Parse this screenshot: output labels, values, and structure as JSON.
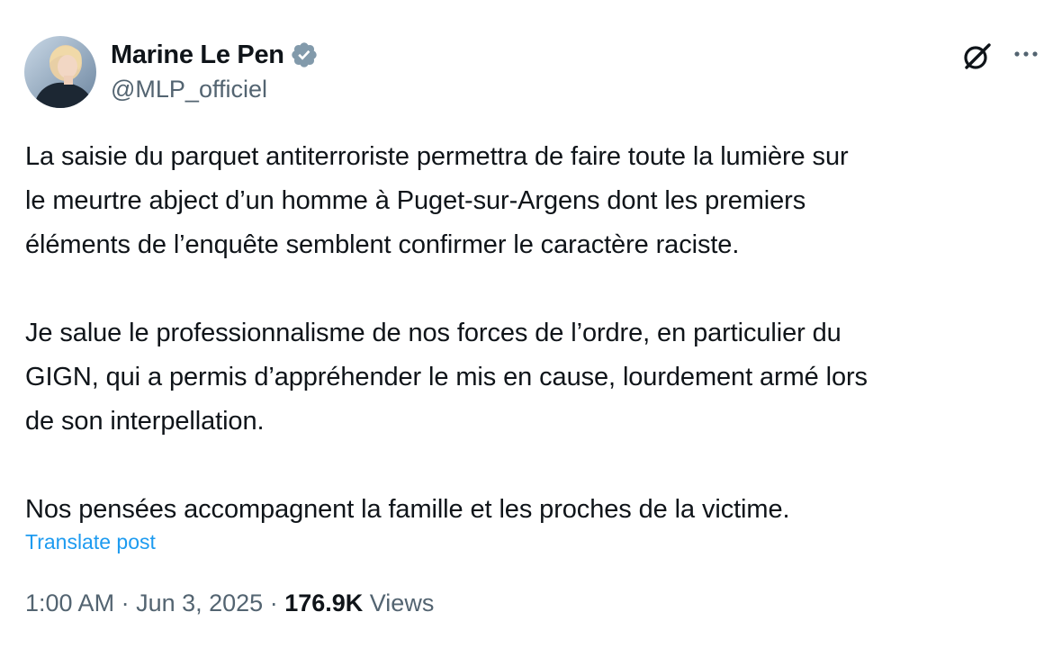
{
  "author": {
    "display_name": "Marine Le Pen",
    "handle": "@MLP_officiel",
    "verified": true,
    "avatar_icon": "profile-photo"
  },
  "post": {
    "paragraphs": [
      "La saisie du parquet antiterroriste permettra de faire toute la lumière sur\nle meurtre abject d’un homme à Puget-sur-Argens dont les premiers\néléments de l’enquête semblent confirmer le caractère raciste.",
      "Je salue le professionnalisme de nos forces de l’ordre, en particulier du\nGIGN, qui a permis d’appréhender le mis en cause, lourdement armé lors\nde son interpellation.",
      "Nos pensées accompagnent la famille et les proches de la victime."
    ],
    "translate_label": "Translate post"
  },
  "meta": {
    "time": "1:00 AM",
    "date": "Jun 3, 2025",
    "separator": " · ",
    "views_count": "176.9K",
    "views_label": "Views"
  },
  "icons": {
    "grok": "grok-icon",
    "more": "more-icon",
    "verified": "verified-badge-icon"
  },
  "colors": {
    "text": "#0f1419",
    "secondary": "#536471",
    "link": "#1d9bf0",
    "verified_badge": "#829aab"
  }
}
